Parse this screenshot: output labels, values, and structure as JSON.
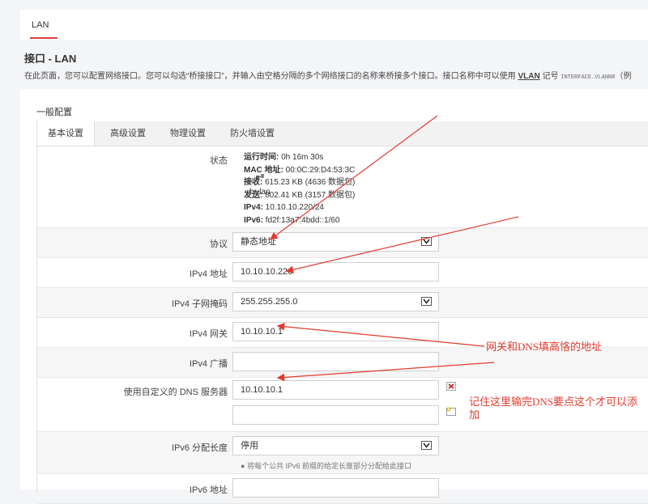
{
  "top_tab": "LAN",
  "page": {
    "title": "接口 - LAN",
    "desc_part1": "在此页面，您可以配置网络接口。您可以勾选“桥接接口”，并输入由空格分隔的多个网络接口的名称来桥接多个接口。接口名称中可以使用 ",
    "desc_vlan": "VLAN",
    "desc_part2": " 记号 ",
    "desc_mono": "INTERFACE.VLANNR",
    "desc_part3": "（例"
  },
  "section_title": "一般配置",
  "subtabs": [
    "基本设置",
    "高级设置",
    "物理设置",
    "防火墙设置"
  ],
  "status": {
    "label": "状态",
    "bridge": "br-lan",
    "lines": [
      {
        "k": "运行时间:",
        "v": " 0h 16m 30s"
      },
      {
        "k": "MAC 地址:",
        "v": " 00:0C:29:D4:53:3C"
      },
      {
        "k": "接收:",
        "v": " 615.23 KB (4636 数据包)"
      },
      {
        "k": "发送:",
        "v": " 802.41 KB (3157 数据包)"
      },
      {
        "k": "IPv4:",
        "v": " 10.10.10.220/24"
      },
      {
        "k": "IPv6:",
        "v": " fd2f:13a7:4bdd::1/60"
      }
    ]
  },
  "fields": {
    "protocol": {
      "label": "协议",
      "value": "静态地址"
    },
    "ipv4_addr": {
      "label": "IPv4 地址",
      "value": "10.10.10.220"
    },
    "netmask": {
      "label": "IPv4 子网掩码",
      "value": "255.255.255.0"
    },
    "gateway": {
      "label": "IPv4 网关",
      "value": "10.10.10.1"
    },
    "broadcast": {
      "label": "IPv4 广播",
      "value": ""
    },
    "dns": {
      "label": "使用自定义的 DNS 服务器",
      "value": "10.10.10.1",
      "value2": ""
    },
    "ipv6_len": {
      "label": "IPv6 分配长度",
      "value": "停用",
      "hint": "将每个公共 IPv6 前缀的给定长度部分分配给此接口"
    },
    "ipv6_addr": {
      "label": "IPv6 地址",
      "value": ""
    }
  },
  "annotations": {
    "gateway_note": "网关和DNS填高恪的地址",
    "dns_note_1": "记住这里输完DNS要点这个才可以添",
    "dns_note_2": "加"
  },
  "colors": {
    "accent": "#d8453e",
    "annotation": "#e23b2e"
  }
}
